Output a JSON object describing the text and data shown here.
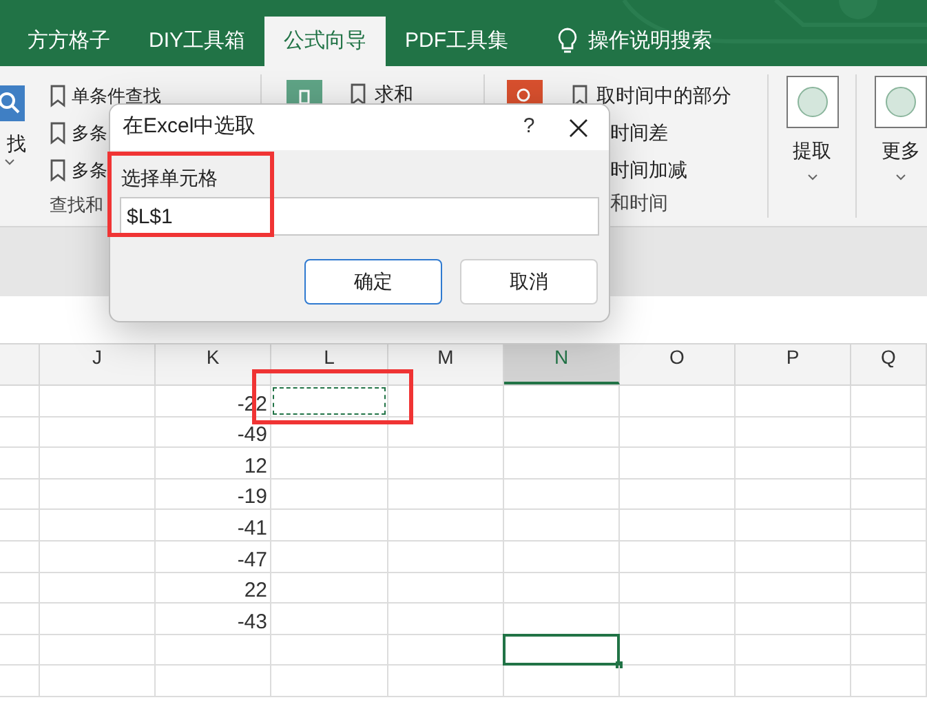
{
  "tabs": [
    {
      "label": "方方格子",
      "selected": false
    },
    {
      "label": "DIY工具箱",
      "selected": false
    },
    {
      "label": "公式向导",
      "selected": true
    },
    {
      "label": "PDF工具集",
      "selected": false
    }
  ],
  "help_search": {
    "label": "操作说明搜索"
  },
  "ribbon": {
    "find_button": {
      "label": "找"
    },
    "find_items": [
      {
        "label": "单条件查找"
      },
      {
        "label": "多条"
      },
      {
        "label": "多条"
      }
    ],
    "find_group_label": "查找和",
    "sum_items": [
      {
        "label": "求和"
      }
    ],
    "time_items": [
      {
        "label": "取时间中的部分",
        "icon": true
      },
      {
        "label": "时间差",
        "icon": false
      },
      {
        "label": "时间加减",
        "icon": false
      }
    ],
    "time_group_label": "和时间",
    "big_buttons": [
      {
        "label": "提取"
      },
      {
        "label": "更多"
      }
    ]
  },
  "dialog": {
    "title": "在Excel中选取",
    "help": "?",
    "field_label": "选择单元格",
    "field_value": "$L$1",
    "buttons": [
      {
        "label": "确定",
        "primary": true
      },
      {
        "label": "取消",
        "primary": false
      }
    ]
  },
  "sheet": {
    "columns": [
      {
        "label": "J",
        "selected": false
      },
      {
        "label": "K",
        "selected": false
      },
      {
        "label": "L",
        "selected": false
      },
      {
        "label": "M",
        "selected": false
      },
      {
        "label": "N",
        "selected": true
      },
      {
        "label": "O",
        "selected": false
      },
      {
        "label": "P",
        "selected": false
      },
      {
        "label": "Q",
        "selected": false
      }
    ],
    "rows": [
      {
        "value": "-22",
        "marquee": true,
        "active": false
      },
      {
        "value": "-49",
        "marquee": false,
        "active": false
      },
      {
        "value": "12",
        "marquee": false,
        "active": false
      },
      {
        "value": "-19",
        "marquee": false,
        "active": false
      },
      {
        "value": "-41",
        "marquee": false,
        "active": false
      },
      {
        "value": "-47",
        "marquee": false,
        "active": false
      },
      {
        "value": "22",
        "marquee": false,
        "active": false
      },
      {
        "value": "-43",
        "marquee": false,
        "active": false
      },
      {
        "marquee": false,
        "active": true
      },
      {
        "marquee": false,
        "active": false
      }
    ]
  }
}
